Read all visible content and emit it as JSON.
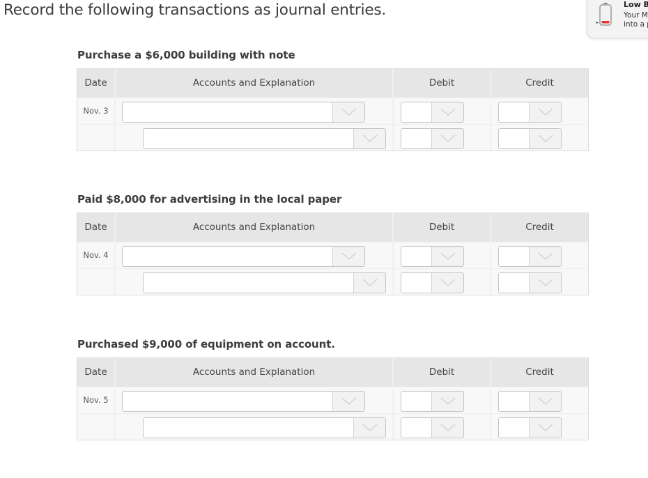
{
  "page": {
    "title": "Record the following transactions as journal entries."
  },
  "notification": {
    "icon": "low-battery-icon",
    "title": "Low Ba",
    "body_line1": "Your M",
    "body_line2": "into a p",
    "battery_level_percent": 10,
    "battery_color": "#e0343a"
  },
  "table_headers": {
    "date": "Date",
    "accounts": "Accounts and Explanation",
    "debit": "Debit",
    "credit": "Credit"
  },
  "sections": [
    {
      "title": "Purchase a $6,000 building with note",
      "date": "Nov. 3",
      "rows": [
        {
          "account": "",
          "debit": "",
          "credit": ""
        },
        {
          "account": "",
          "debit": "",
          "credit": ""
        }
      ]
    },
    {
      "title": "Paid $8,000 for advertising in the local paper",
      "date": "Nov. 4",
      "rows": [
        {
          "account": "",
          "debit": "",
          "credit": ""
        },
        {
          "account": "",
          "debit": "",
          "credit": ""
        }
      ]
    },
    {
      "title": "Purchased $9,000 of equipment on account.",
      "date": "Nov. 5",
      "rows": [
        {
          "account": "",
          "debit": "",
          "credit": ""
        },
        {
          "account": "",
          "debit": "",
          "credit": ""
        }
      ]
    }
  ],
  "icons": {
    "dropdown": "chevron-down-icon"
  }
}
